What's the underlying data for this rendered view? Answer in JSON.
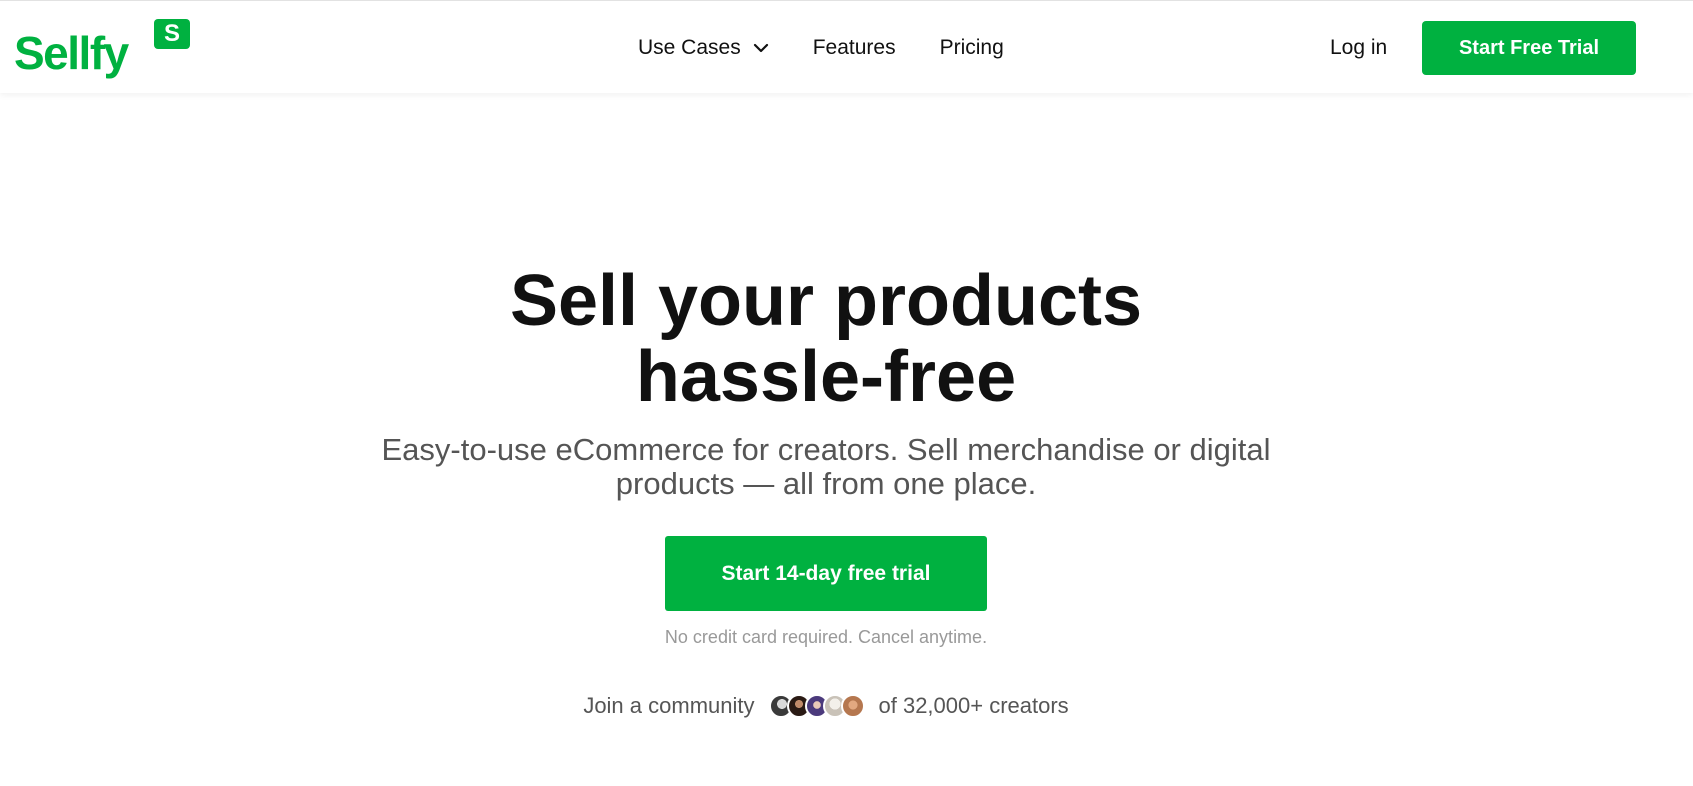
{
  "brand": {
    "name": "Sellfy",
    "badge": "S",
    "accent_color": "#00b140"
  },
  "nav": {
    "use_cases": "Use Cases",
    "features": "Features",
    "pricing": "Pricing",
    "login": "Log in",
    "cta": "Start Free Trial"
  },
  "hero": {
    "headline_line1": "Sell your products",
    "headline_line2": "hassle-free",
    "subhead_line1": "Easy-to-use eCommerce for creators. Sell merchandise or digital",
    "subhead_line2": "products — all from one place.",
    "cta": "Start 14-day free trial",
    "note": "No credit card required. Cancel anytime.",
    "community_prefix": "Join a community",
    "community_suffix": "of 32,000+ creators"
  }
}
